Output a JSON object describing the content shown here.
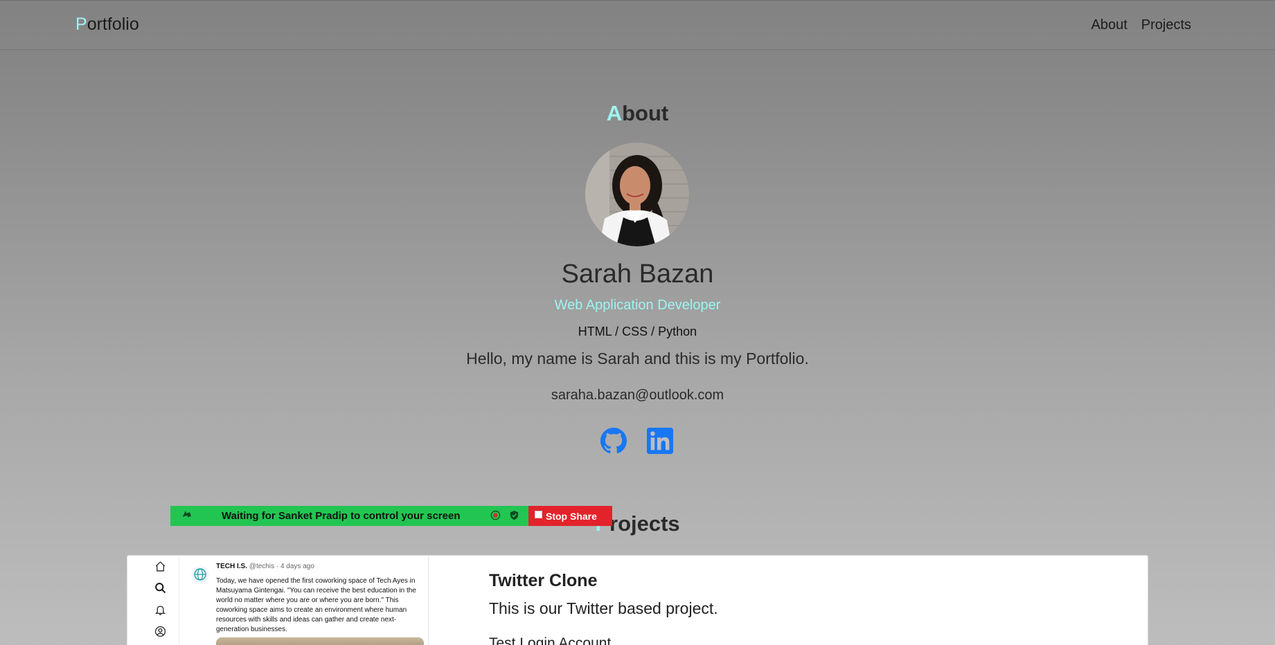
{
  "navbar": {
    "brand_initial": "P",
    "brand_rest": "ortfolio",
    "links": [
      "About",
      "Projects"
    ]
  },
  "about": {
    "title_initial": "A",
    "title_rest": "bout",
    "name": "Sarah Bazan",
    "role": "Web Application Developer",
    "skills": "HTML / CSS / Python",
    "intro": "Hello, my name is Sarah and this is my Portfolio.",
    "email": "saraha.bazan@outlook.com",
    "socials": [
      "github-icon",
      "linkedin-icon"
    ]
  },
  "projects": {
    "title_initial": "P",
    "title_rest": "rojects",
    "items": [
      {
        "title": "Twitter Clone",
        "description": "This is our Twitter based project.",
        "login_label": "Test Login Account",
        "thumb": {
          "account_name": "TECH I.S.",
          "account_meta": "@techis · 4 days ago",
          "tweet_text": "Today, we have opened the first coworking space of Tech Ayes in Matsuyama Gintengai. \"You can receive the best education in the world no matter where you are or where you are born.\" This coworking space aims to create an environment where human resources with skills and ideas can gather and create next-generation businesses."
        }
      }
    ]
  },
  "screen_share": {
    "message": "Waiting for Sanket Pradip to control your screen",
    "stop_label": "Stop Share"
  },
  "colors": {
    "accent": "#9ff3f0",
    "share_green": "#23c552",
    "share_red": "#e2232c",
    "social_blue": "#1877f2"
  }
}
